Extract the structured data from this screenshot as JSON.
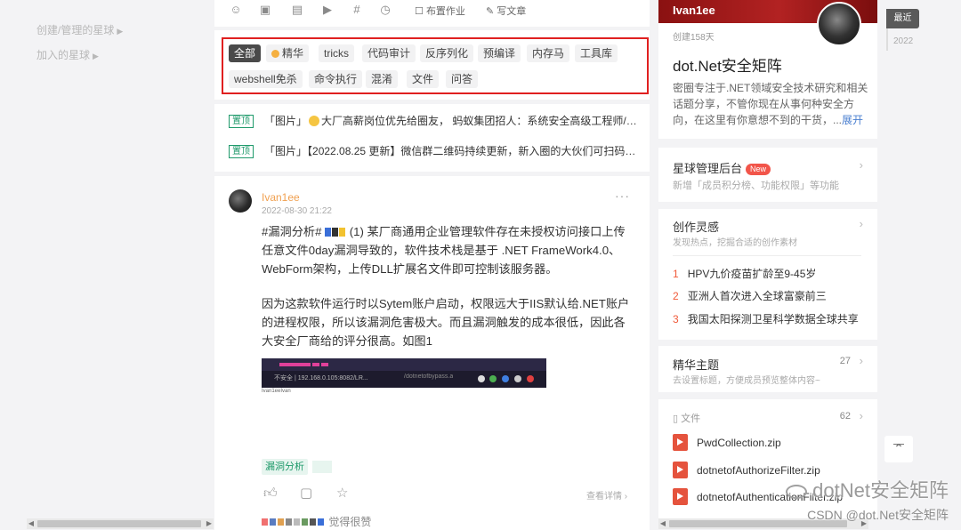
{
  "left_nav": {
    "items": [
      {
        "label": "创建/管理的星球"
      },
      {
        "label": "加入的星球"
      }
    ]
  },
  "toolbar": {
    "homework_label": "布置作业",
    "article_label": "写文章"
  },
  "tags": [
    {
      "label": "全部",
      "active": true
    },
    {
      "label": "精华"
    },
    {
      "label": "tricks"
    },
    {
      "label": "代码审计"
    },
    {
      "label": "反序列化"
    },
    {
      "label": "预编译"
    },
    {
      "label": "内存马"
    },
    {
      "label": "工具库"
    },
    {
      "label": "webshell免杀"
    },
    {
      "label": "命令执行"
    },
    {
      "label": "混淆"
    },
    {
      "label": "文件"
    },
    {
      "label": "问答"
    }
  ],
  "pinned": [
    {
      "badge": "置顶",
      "prefix": "「图片」",
      "text": "大厂高薪岗位优先给圈友， 蚂蚁集团招人：系统安全高级工程师/专..."
    },
    {
      "badge": "置顶",
      "prefix": "「图片」",
      "text": "【2022.08.25 更新】微信群二维码持续更新，新入圈的大伙们可扫码加..."
    }
  ],
  "post": {
    "author": "Ivan1ee",
    "time": "2022-08-30 21:22",
    "more": "···",
    "para1_head": "#漏洞分析#",
    "para1_tail": "(1) 某厂商通用企业管理软件存在未授权访问接口上传任意文件0day漏洞导致的，软件技术栈是基于 .NET FrameWork4.0、WebForm架构，上传DLL扩展名文件即可控制该服务器。",
    "para2": "因为这款软件运行时以Sytem账户启动，权限远大于IIS默认给.NET账户的进程权限，所以该漏洞危害极大。而且漏洞触发的成本很低，因此各大安全厂商给的评分很高。如图1",
    "screenshot_url": "不安全 | 192.168.0.105:8082/LR...",
    "screenshot_path": "/dotnetofbypass.asp...",
    "screenshot_caption": "Ivan1eeIvan",
    "hashtag": "漏洞分析",
    "detail_label": "查看详情 ›",
    "likes_suffix": "觉得很赞"
  },
  "sidebar": {
    "hero": {
      "owner": "Ivan1ee",
      "created": "创建158天",
      "name": "dot.Net安全矩阵",
      "description": "密圈专注于.NET领域安全技术研究和相关话题分享，不管你现在从事何种安全方向，在这里有你意想不到的干货，...",
      "expand": "展开"
    },
    "admin": {
      "title": "星球管理后台",
      "badge": "New",
      "subtitle": "新增「成员积分榜、功能权限」等功能"
    },
    "inspiration": {
      "title": "创作灵感",
      "subtitle": "发现热点，挖掘合适的创作素材",
      "hot": [
        {
          "n": "1",
          "text": "HPV九价疫苗扩龄至9-45岁"
        },
        {
          "n": "2",
          "text": "亚洲人首次进入全球富豪前三"
        },
        {
          "n": "3",
          "text": "我国太阳探测卫星科学数据全球共享"
        }
      ]
    },
    "featured": {
      "title": "精华主题",
      "count": "27",
      "subtitle": "去设置标题，方便成员预览整体内容~"
    },
    "files": {
      "title": "文件",
      "count": "62",
      "items": [
        {
          "name": "PwdCollection.zip"
        },
        {
          "name": "dotnetofAuthorizeFilter.zip"
        },
        {
          "name": "dotnetofAuthenticationFilter.zip"
        }
      ]
    }
  },
  "timeline": {
    "active": "最近",
    "year": "2022"
  },
  "watermark": {
    "title": "dotNet安全矩阵",
    "sub": "CSDN @dot.Net安全矩阵"
  }
}
